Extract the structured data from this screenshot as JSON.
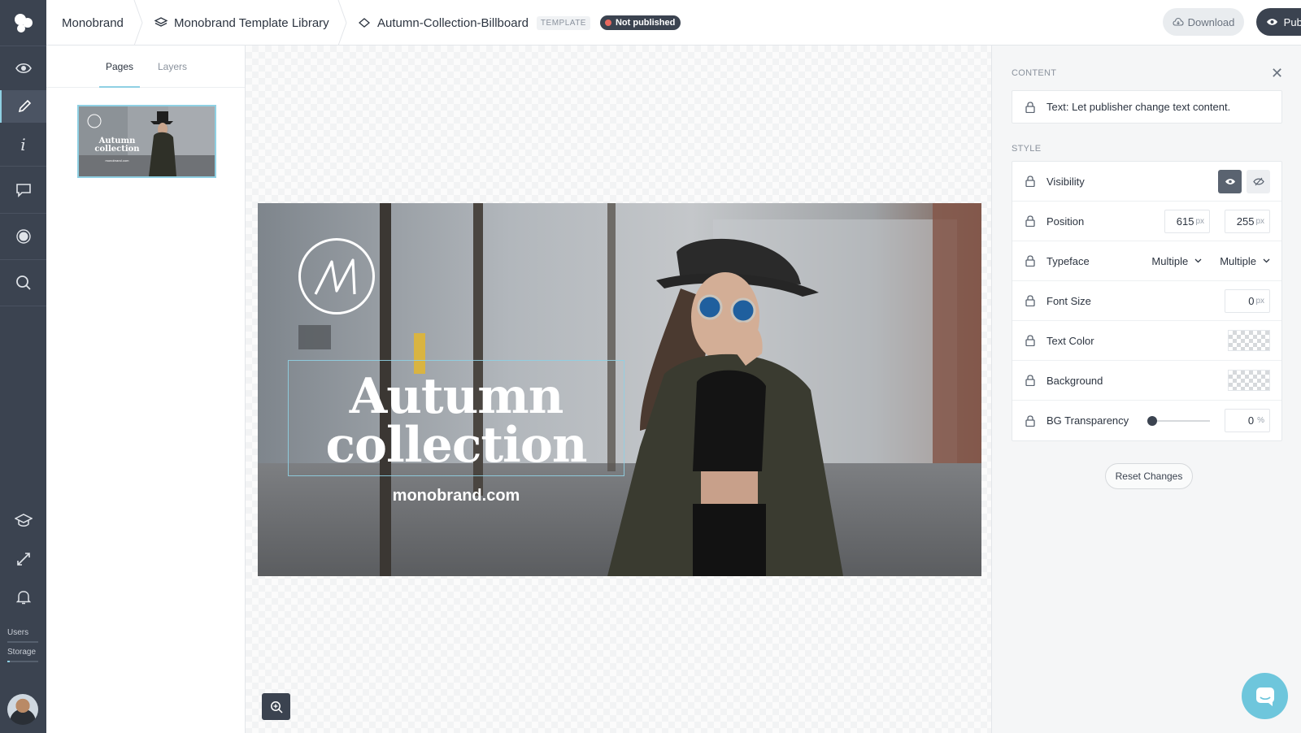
{
  "app": {
    "brand": "Monobrand"
  },
  "breadcrumb": {
    "root": "Monobrand",
    "library": "Monobrand Template Library",
    "document": "Autumn-Collection-Billboard",
    "template_badge": "TEMPLATE",
    "status_badge": "Not published"
  },
  "header": {
    "download_label": "Download",
    "publish_label": "Publish"
  },
  "sidebar": {
    "icons": [
      "preview-eye-icon",
      "edit-pencil-icon",
      "info-icon",
      "comments-icon",
      "record-dot-icon",
      "search-icon",
      "academy-cap-icon",
      "fullscreen-expand-icon",
      "notification-bell-icon"
    ],
    "users_label": "Users",
    "storage_label": "Storage"
  },
  "pages_panel": {
    "tabs": [
      "Pages",
      "Layers"
    ],
    "active_tab": "Pages"
  },
  "thumbnail": {
    "title": "Autumn collection",
    "url": "monobrand.com"
  },
  "billboard": {
    "title_line1": "Autumn",
    "title_line2": "collection",
    "url": "monobrand.com"
  },
  "inspector": {
    "content_label": "CONTENT",
    "content_text": "Text: Let publisher change text content.",
    "style_label": "STYLE",
    "rows": {
      "visibility": "Visibility",
      "position": "Position",
      "typeface": "Typeface",
      "font_size": "Font Size",
      "text_color": "Text Color",
      "background": "Background",
      "bg_transparency": "BG Transparency"
    },
    "position_x": "615",
    "position_y": "255",
    "unit_px": "px",
    "typeface_family": "Multiple",
    "typeface_weight": "Multiple",
    "font_size": "0",
    "bg_transparency_value": "0",
    "unit_percent": "%",
    "bg_transparency_level": 0,
    "reset_label": "Reset Changes"
  },
  "colors": {
    "rail": "#3b4350",
    "accent": "#8fd0e3",
    "status_dot": "#e8685f",
    "chat": "#6ec6dc"
  }
}
